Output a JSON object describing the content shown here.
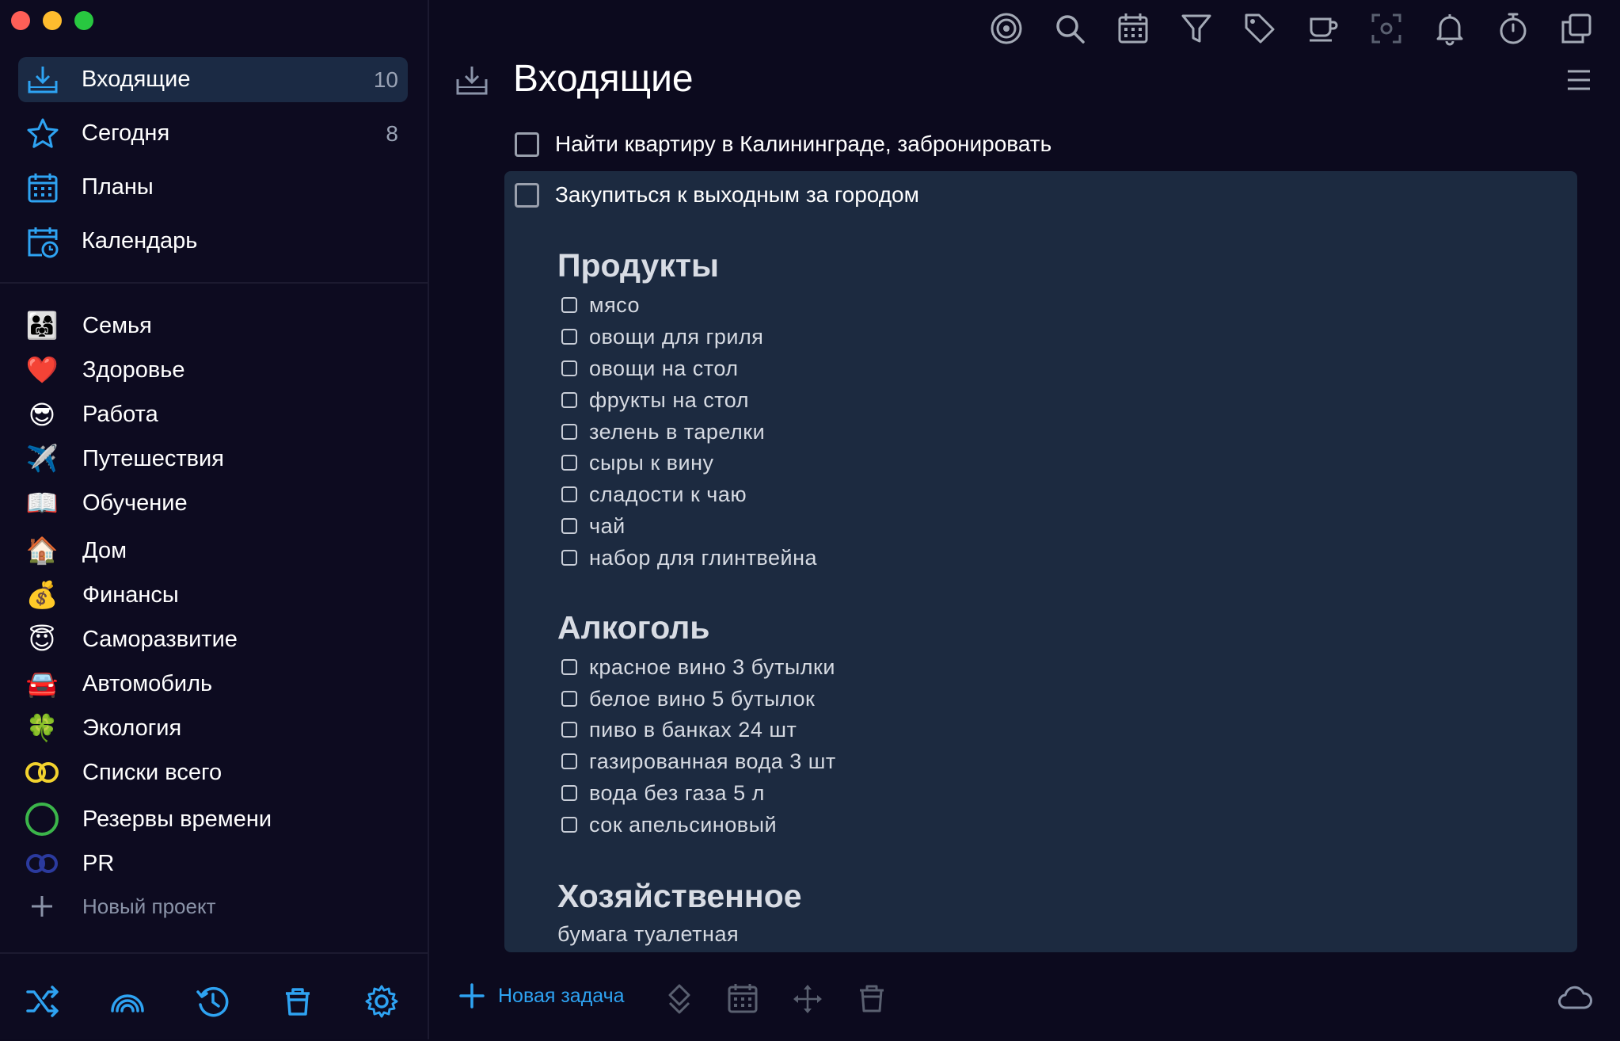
{
  "sidebar": {
    "nav": [
      {
        "label": "Входящие",
        "count": "10",
        "icon": "inbox-icon"
      },
      {
        "label": "Сегодня",
        "count": "8",
        "icon": "star-icon"
      },
      {
        "label": "Планы",
        "count": "",
        "icon": "calendar-grid-icon"
      },
      {
        "label": "Календарь",
        "count": "",
        "icon": "calendar-clock-icon"
      }
    ],
    "projects": [
      {
        "emoji": "👨‍👩‍👧",
        "label": "Семья"
      },
      {
        "emoji": "❤️",
        "label": "Здоровье"
      },
      {
        "emoji": "😎",
        "label": "Работа"
      },
      {
        "emoji": "✈️",
        "label": "Путешествия"
      },
      {
        "emoji": "📖",
        "label": "Обучение"
      },
      {
        "emoji": "🏠",
        "label": "Дом"
      },
      {
        "emoji": "💰",
        "label": "Финансы"
      },
      {
        "emoji": "😇",
        "label": "Саморазвитие"
      },
      {
        "emoji": "🚘",
        "label": "Автомобиль"
      },
      {
        "emoji": "🍀",
        "label": "Экология"
      },
      {
        "emoji": "",
        "label": "Списки всего"
      },
      {
        "emoji": "",
        "label": "Резервы времени"
      },
      {
        "emoji": "",
        "label": "PR"
      }
    ],
    "new_project": "Новый проект"
  },
  "main": {
    "title": "Входящие",
    "tasks": [
      {
        "text": "Найти квартиру в Калининграде, забронировать"
      },
      {
        "text": "Закупиться к выходным за городом"
      }
    ],
    "note": {
      "sections": [
        {
          "title": "Продукты",
          "items": [
            "мясо",
            "овощи для гриля",
            "овощи на стол",
            "фрукты на стол",
            "зелень в тарелки",
            "сыры к вину",
            "сладости к чаю",
            "чай",
            "набор для глинтвейна"
          ]
        },
        {
          "title": "Алкоголь",
          "items": [
            "красное вино 3 бутылки",
            "белое вино 5 бутылок",
            "пиво в банках 24 шт",
            "газированная вода 3 шт",
            "вода без газа 5 л",
            "сок апельсиновый"
          ]
        },
        {
          "title": "Хозяйственное",
          "plain": "бумага туалетная"
        }
      ]
    },
    "new_task": "Новая задача"
  },
  "colors": {
    "accent": "#2ea3f2",
    "sidebar_active": "#1b2a44",
    "card_bg": "#1c2a40",
    "background": "#0c0a1e"
  }
}
